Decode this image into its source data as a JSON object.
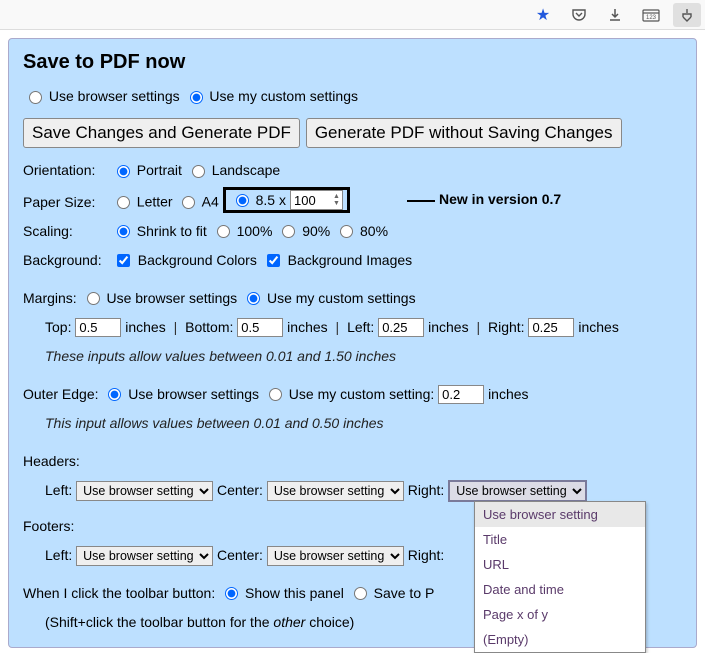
{
  "header": {
    "title": "Save to PDF now"
  },
  "settingsMode": {
    "browser": "Use browser settings",
    "custom": "Use my custom settings"
  },
  "buttons": {
    "saveAndGen": "Save Changes and Generate PDF",
    "genNoSave": "Generate PDF without Saving Changes"
  },
  "orientation": {
    "label": "Orientation:",
    "portrait": "Portrait",
    "landscape": "Landscape"
  },
  "paper": {
    "label": "Paper Size:",
    "letter": "Letter",
    "a4": "A4",
    "customPrefix": "8.5 x",
    "customValue": "100"
  },
  "callout": {
    "text": "New in version 0.7"
  },
  "scaling": {
    "label": "Scaling:",
    "shrink": "Shrink to fit",
    "p100": "100%",
    "p90": "90%",
    "p80": "80%"
  },
  "background": {
    "label": "Background:",
    "colors": "Background Colors",
    "images": "Background Images"
  },
  "margins": {
    "label": "Margins:",
    "browser": "Use browser settings",
    "custom": "Use my custom settings",
    "topLabel": "Top:",
    "top": "0.5",
    "bottomLabel": "Bottom:",
    "bottom": "0.5",
    "leftLabel": "Left:",
    "left": "0.25",
    "rightLabel": "Right:",
    "right": "0.25",
    "unit": "inches",
    "note": "These inputs allow values between 0.01 and 1.50 inches"
  },
  "outer": {
    "label": "Outer Edge:",
    "browser": "Use browser settings",
    "custom": "Use my custom setting:",
    "value": "0.2",
    "unit": "inches",
    "note": "This input allows values between 0.01 and 0.50 inches"
  },
  "headers": {
    "label": "Headers:",
    "left": "Left:",
    "center": "Center:",
    "right": "Right:",
    "option": "Use browser setting"
  },
  "footers": {
    "label": "Footers:",
    "left": "Left:",
    "center": "Center:",
    "right": "Right:",
    "option": "Use browser setting"
  },
  "dropdown": {
    "items": [
      "Use browser setting",
      "Title",
      "URL",
      "Date and time",
      "Page x of y",
      "(Empty)"
    ]
  },
  "toolbarClick": {
    "label": "When I click the toolbar button:",
    "showPanel": "Show this panel",
    "saveToP": "Save to P",
    "hint_a": "(Shift+click the toolbar button for the ",
    "hint_b": "other",
    "hint_c": " choice)"
  }
}
